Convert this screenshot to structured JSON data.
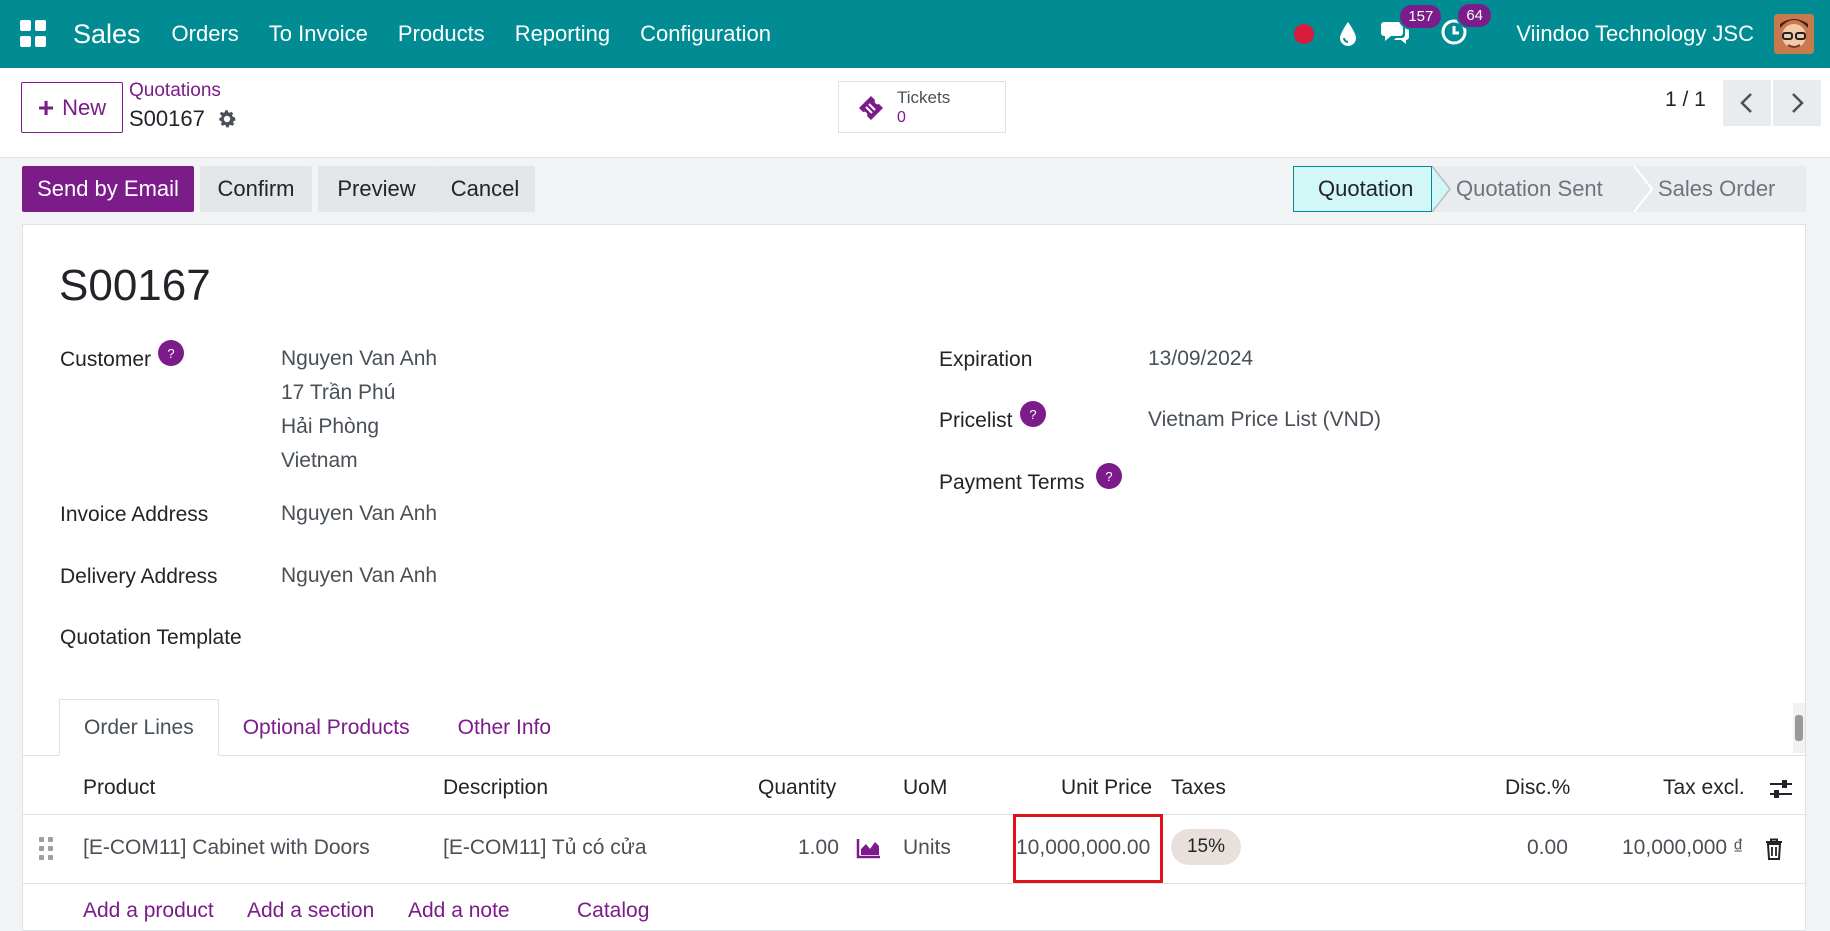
{
  "topbar": {
    "app_name": "Sales",
    "menu": [
      "Orders",
      "To Invoice",
      "Products",
      "Reporting",
      "Configuration"
    ],
    "messages_count": "157",
    "activities_count": "64",
    "company": "Viindoo Technology JSC"
  },
  "control_panel": {
    "new_label": "New",
    "breadcrumb_parent": "Quotations",
    "breadcrumb_current": "S00167",
    "smart_button": {
      "label": "Tickets",
      "value": "0"
    },
    "pager": "1 / 1"
  },
  "statusbar": {
    "buttons": [
      "Send by Email",
      "Confirm",
      "Preview",
      "Cancel"
    ],
    "stages": [
      "Quotation",
      "Quotation Sent",
      "Sales Order"
    ],
    "active_stage": "Quotation"
  },
  "form": {
    "title": "S00167",
    "customer_label": "Customer",
    "customer_lines": [
      "Nguyen Van Anh",
      "17 Trần Phú",
      "Hải Phòng",
      "Vietnam"
    ],
    "invoice_address_label": "Invoice Address",
    "invoice_address": "Nguyen Van Anh",
    "delivery_address_label": "Delivery Address",
    "delivery_address": "Nguyen Van Anh",
    "quotation_template_label": "Quotation Template",
    "expiration_label": "Expiration",
    "expiration": "13/09/2024",
    "pricelist_label": "Pricelist",
    "pricelist": "Vietnam Price List (VND)",
    "payment_terms_label": "Payment Terms",
    "help_mark": "?"
  },
  "tabs": [
    "Order Lines",
    "Optional Products",
    "Other Info"
  ],
  "order_lines": {
    "headers": {
      "product": "Product",
      "description": "Description",
      "quantity": "Quantity",
      "uom": "UoM",
      "unit_price": "Unit Price",
      "taxes": "Taxes",
      "discount": "Disc.%",
      "subtotal": "Tax excl."
    },
    "rows": [
      {
        "product": "[E-COM11] Cabinet with Doors",
        "description": "[E-COM11] Tủ có cửa",
        "quantity": "1.00",
        "uom": "Units",
        "unit_price": "10,000,000.00",
        "taxes": "15%",
        "discount": "0.00",
        "subtotal": "10,000,000 ₫"
      }
    ],
    "add_links": [
      "Add a product",
      "Add a section",
      "Add a note",
      "Catalog"
    ]
  },
  "colors": {
    "navbar": "#018c94",
    "primary": "#7b1c8a",
    "highlight_box": "#e0121c"
  }
}
